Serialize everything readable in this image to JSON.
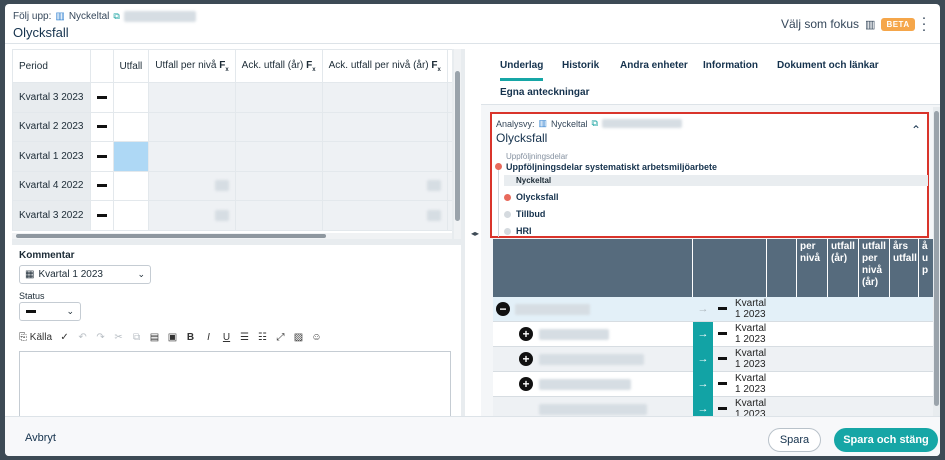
{
  "header": {
    "crumb_label": "Följ upp:",
    "crumb_type": "Nyckeltal",
    "title": "Olycksfall",
    "focus_label": "Välj som fokus",
    "beta": "BETA"
  },
  "left_table": {
    "columns": [
      "Period",
      "",
      "Utfall",
      "Utfall per nivå",
      "Ack. utfall (år)",
      "Ack. utfall per nivå (år)"
    ],
    "rows": [
      "Kvartal 3 2023",
      "Kvartal 2 2023",
      "Kvartal 1 2023",
      "Kvartal 4 2022",
      "Kvartal 3 2022"
    ]
  },
  "comment": {
    "label": "Kommentar",
    "period": "Kvartal 1 2023",
    "status_label": "Status",
    "toolbar_source": "Källa"
  },
  "tabs": [
    "Underlag",
    "Historik",
    "Andra enheter",
    "Information",
    "Dokument och länkar",
    "Egna anteckningar"
  ],
  "popup": {
    "crumb_label": "Analysvy:",
    "crumb_type": "Nyckeltal",
    "title": "Olycksfall",
    "group_label": "Uppföljningsdelar",
    "group_item": "Uppföljningsdelar systematiskt arbetsmiljöarbete",
    "kpi_label": "Nyckeltal",
    "items": [
      "Olycksfall",
      "Tillbud",
      "HRI"
    ]
  },
  "grid": {
    "headers": [
      "per nivå",
      "utfall (år)",
      "utfall per nivå (år)",
      "års utfall",
      "å u p"
    ],
    "quarter": [
      "Kvartal",
      "1 2023"
    ]
  },
  "footer": {
    "cancel": "Avbryt",
    "save": "Spara",
    "save_close": "Spara och stäng"
  },
  "colors": {
    "accent": "#16a6a6",
    "header_band": "#566b7d",
    "highlight": "#aed8f5",
    "popup_border": "#d9342b"
  }
}
